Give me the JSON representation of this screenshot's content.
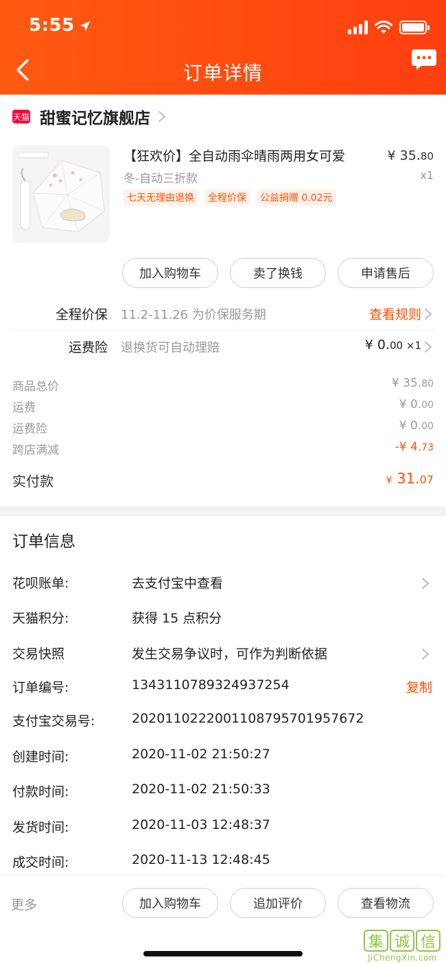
{
  "status_bar": {
    "time": "5:55"
  },
  "header": {
    "title": "订单详情"
  },
  "shop": {
    "badge": "天猫",
    "name": "甜蜜记忆旗舰店"
  },
  "product": {
    "title": "【狂欢价】全自动雨伞晴雨两用女可爱",
    "price_int": "¥ 35.",
    "price_dec": "80",
    "sku": "冬-自动三折款",
    "qty": "x1",
    "tags": [
      "七天无理由退换",
      "全程价保",
      "公益捐赠 0.02元"
    ]
  },
  "product_actions": {
    "add_cart": "加入购物车",
    "sell": "卖了换钱",
    "after_sale": "申请售后"
  },
  "price_protect": {
    "label": "全程价保",
    "desc": "11.2-11.26 为价保服务期",
    "link": "查看规则"
  },
  "shipping_insurance": {
    "label": "运费险",
    "desc": "退换货可自动理赔",
    "value_int": "¥ 0.",
    "value_dec": "00",
    "qty": " ×1"
  },
  "summary": {
    "rows": [
      {
        "label": "商品总价",
        "int": "¥ 35.",
        "dec": "80"
      },
      {
        "label": "运费",
        "int": "¥ 0.",
        "dec": "00"
      },
      {
        "label": "运费险",
        "int": "¥ 0.",
        "dec": "00"
      },
      {
        "label": "跨店满减",
        "int": "-¥ 4.",
        "dec": "73"
      }
    ],
    "paid_label": "实付款",
    "paid_cur": "¥",
    "paid_int": " 31.",
    "paid_dec": "07"
  },
  "order_info": {
    "title": "订单信息",
    "rows": [
      {
        "label": "花呗账单:",
        "value": "去支付宝中查看"
      },
      {
        "label": "天猫积分:",
        "value": "获得 15 点积分"
      },
      {
        "label": "交易快照",
        "value": "发生交易争议时，可作为判断依据"
      },
      {
        "label": "订单编号:",
        "value": "1343110789324937254"
      },
      {
        "label": "支付宝交易号:",
        "value": "2020110222001108795701957672"
      },
      {
        "label": "创建时间:",
        "value": "2020-11-02 21:50:27"
      },
      {
        "label": "付款时间:",
        "value": "2020-11-02 21:50:33"
      },
      {
        "label": "发货时间:",
        "value": "2020-11-03 12:48:37"
      },
      {
        "label": "成交时间:",
        "value": "2020-11-13 12:48:45"
      }
    ],
    "copy_label": "复制"
  },
  "bottom_bar": {
    "more": "更多",
    "add_cart": "加入购物车",
    "add_review": "追加评价",
    "view_logistics": "查看物流"
  },
  "watermark": {
    "glyphs": [
      "集",
      "诚",
      "信"
    ],
    "url": "JiChengXin.com"
  },
  "colors": {
    "brand_orange": "#ff5000",
    "header_bg": "#ff4a10",
    "tmall_red": "#ff0036"
  }
}
